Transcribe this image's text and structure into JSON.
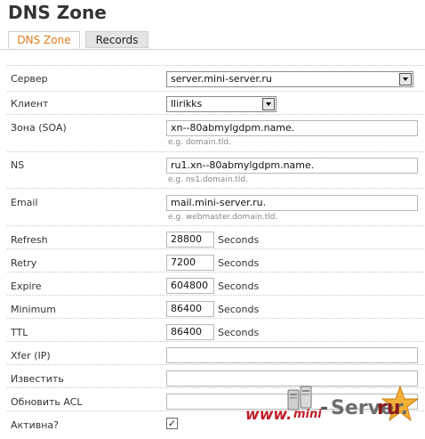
{
  "page": {
    "title": "DNS Zone"
  },
  "tabs": [
    {
      "label": "DNS Zone",
      "active": true
    },
    {
      "label": "Records",
      "active": false
    }
  ],
  "form": {
    "server": {
      "label": "Сервер",
      "value": "server.mini-server.ru"
    },
    "client": {
      "label": "Клиент",
      "value": "llirikks"
    },
    "zone": {
      "label": "Зона (SOA)",
      "value": "xn--80abmylgdpm.name.",
      "hint": "e.g. domain.tld."
    },
    "ns": {
      "label": "NS",
      "value": "ru1.xn--80abmylgdpm.name.",
      "hint": "e.g. ns1.domain.tld."
    },
    "email": {
      "label": "Email",
      "value": "mail.mini-server.ru.",
      "hint": "e.g. webmaster.domain.tld."
    },
    "refresh": {
      "label": "Refresh",
      "value": "28800",
      "unit": "Seconds"
    },
    "retry": {
      "label": "Retry",
      "value": "7200",
      "unit": "Seconds"
    },
    "expire": {
      "label": "Expire",
      "value": "604800",
      "unit": "Seconds"
    },
    "minimum": {
      "label": "Minimum",
      "value": "86400",
      "unit": "Seconds"
    },
    "ttl": {
      "label": "TTL",
      "value": "86400",
      "unit": "Seconds"
    },
    "xfer": {
      "label": "Xfer (IP)",
      "value": ""
    },
    "notify": {
      "label": "Известить",
      "value": ""
    },
    "update_acl": {
      "label": "Обновить ACL",
      "value": ""
    },
    "active": {
      "label": "Активна?",
      "checked": true,
      "mark": "✓"
    }
  },
  "watermark": {
    "www": "www.",
    "mini": "mini",
    "dash": "-",
    "server": "Server.",
    "ru": "ru"
  }
}
